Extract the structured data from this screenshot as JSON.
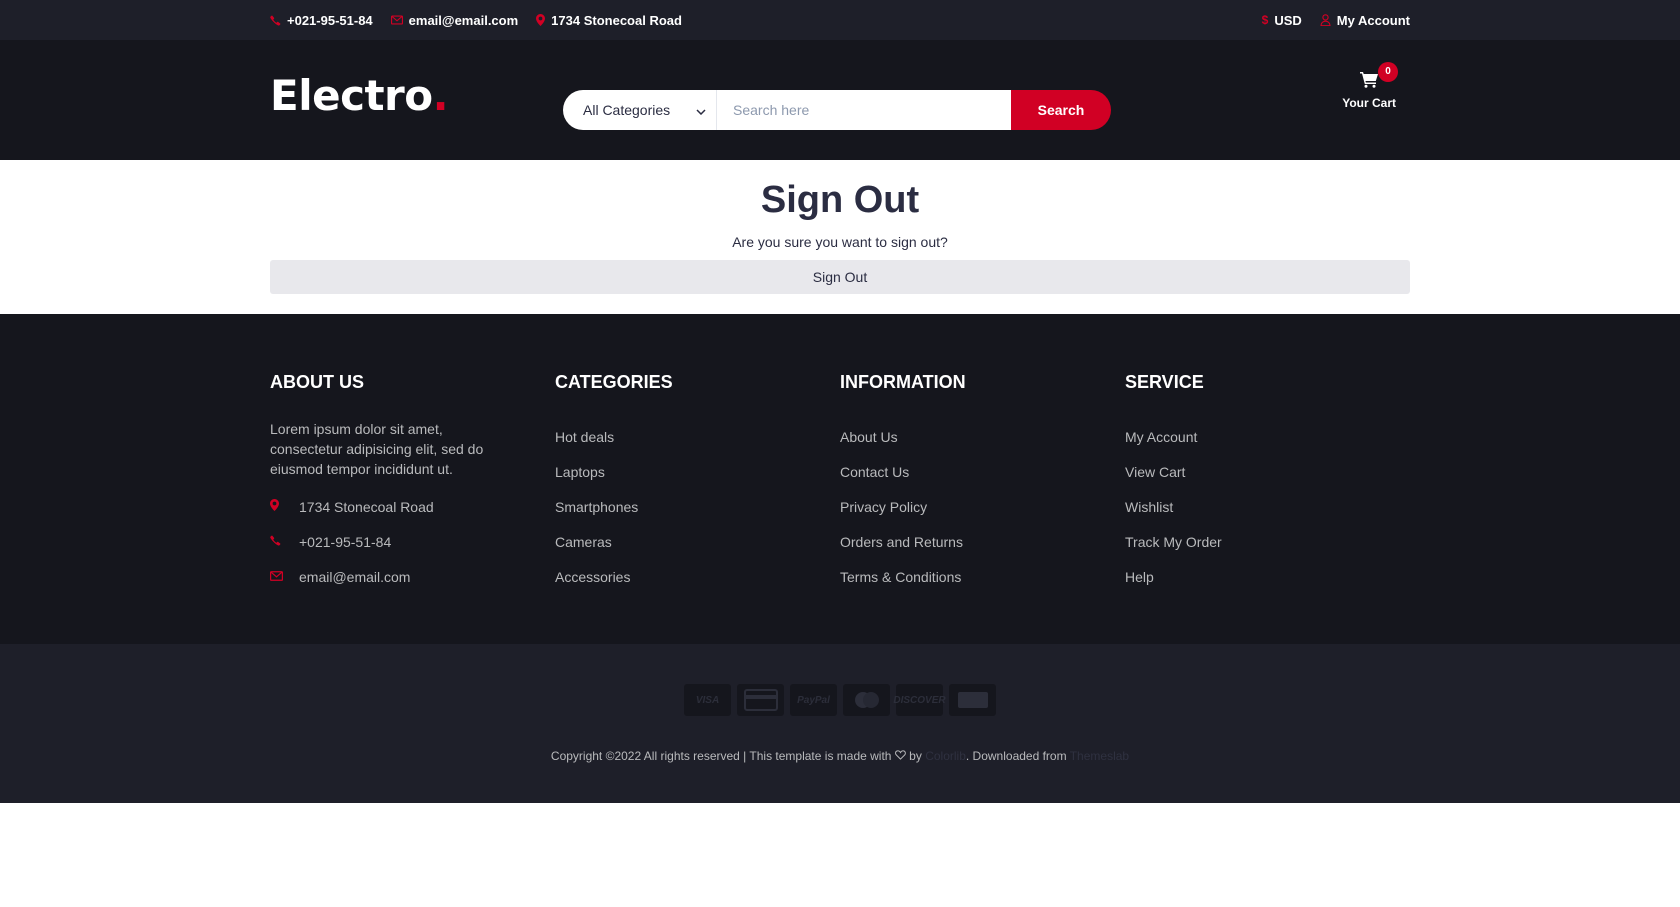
{
  "top_bar": {
    "phone": "+021-95-51-84",
    "email": "email@email.com",
    "address": "1734 Stonecoal Road",
    "currency": "USD",
    "account": "My Account"
  },
  "header": {
    "logo_text": "Electro",
    "logo_dot": ".",
    "category_selected": "All Categories",
    "search_placeholder": "Search here",
    "search_button": "Search",
    "cart_label": "Your Cart",
    "cart_qty": "0"
  },
  "main": {
    "title": "Sign Out",
    "subtitle": "Are you sure you want to sign out?",
    "button": "Sign Out"
  },
  "footer": {
    "about": {
      "title": "About Us",
      "text": "Lorem ipsum dolor sit amet, consectetur adipisicing elit, sed do eiusmod tempor incididunt ut.",
      "address": "1734 Stonecoal Road",
      "phone": "+021-95-51-84",
      "email": "email@email.com"
    },
    "categories": {
      "title": "Categories",
      "items": [
        "Hot deals",
        "Laptops",
        "Smartphones",
        "Cameras",
        "Accessories"
      ]
    },
    "information": {
      "title": "Information",
      "items": [
        "About Us",
        "Contact Us",
        "Privacy Policy",
        "Orders and Returns",
        "Terms & Conditions"
      ]
    },
    "service": {
      "title": "Service",
      "items": [
        "My Account",
        "View Cart",
        "Wishlist",
        "Track My Order",
        "Help"
      ]
    },
    "payments": [
      "VISA",
      "credit-card",
      "PayPal",
      "mastercard",
      "DISCOVER",
      "amex"
    ],
    "copyright_pre": "Copyright ©2022 All rights reserved | This template is made with",
    "copyright_by": "by",
    "colorlib": "Colorlib",
    "downloaded": ". Downloaded from",
    "themeslab": "Themeslab"
  },
  "colors": {
    "accent": "#d10024",
    "dark": "#15161d",
    "topbar": "#1e1f29"
  }
}
